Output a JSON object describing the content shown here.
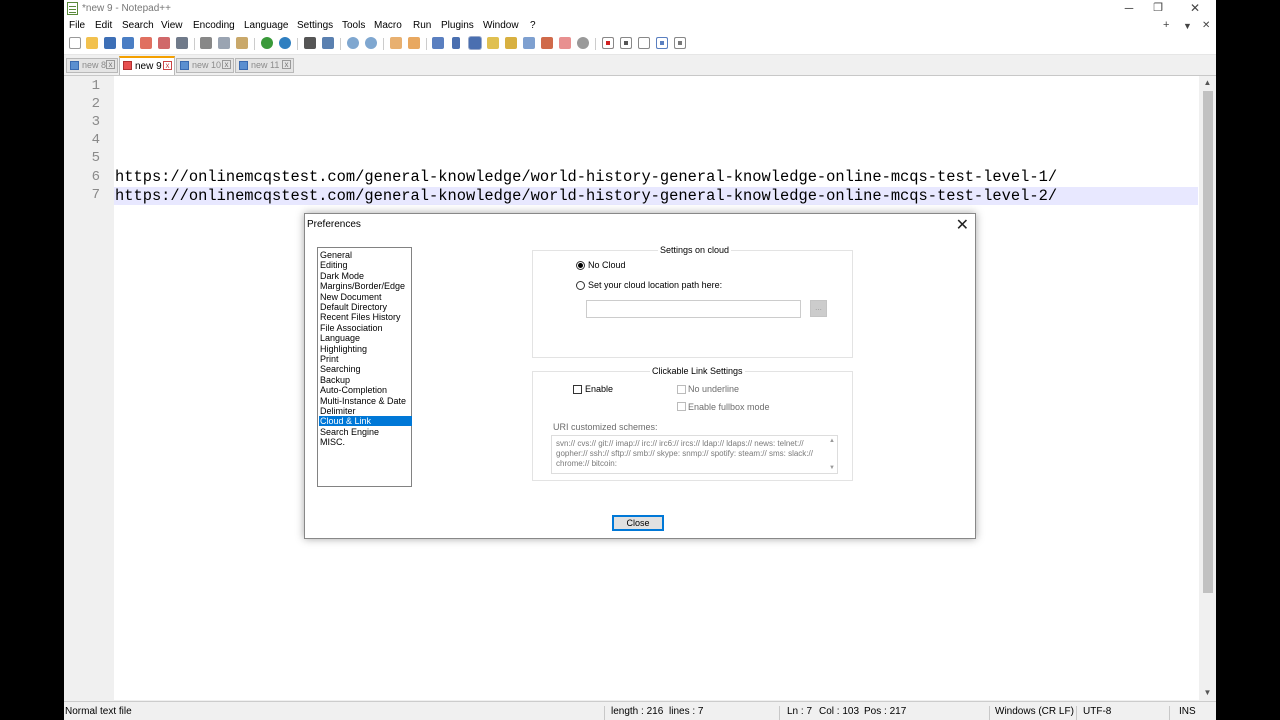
{
  "window": {
    "title": "*new 9 - Notepad++",
    "minimize": "─",
    "restore": "❐",
    "close": "✕"
  },
  "menu": [
    "File",
    "Edit",
    "Search",
    "View",
    "Encoding",
    "Language",
    "Settings",
    "Tools",
    "Macro",
    "Run",
    "Plugins",
    "Window",
    "?"
  ],
  "menu_right": {
    "plus": "+",
    "down": "▼",
    "close": "✕"
  },
  "tabs": [
    {
      "label": "new 8",
      "active": false
    },
    {
      "label": "new 9",
      "active": true
    },
    {
      "label": "new 10",
      "active": false
    },
    {
      "label": "new 11",
      "active": false
    }
  ],
  "tab_close_glyph": "x",
  "editor": {
    "line_numbers": [
      "1",
      "2",
      "3",
      "4",
      "5",
      "6",
      "7"
    ],
    "lines": [
      "",
      "",
      "",
      "",
      "",
      "https://onlinemcqstest.com/general-knowledge/world-history-general-knowledge-online-mcqs-test-level-1/",
      "https://onlinemcqstest.com/general-knowledge/world-history-general-knowledge-online-mcqs-test-level-2/"
    ]
  },
  "scroll": {
    "up": "▲",
    "down": "▼"
  },
  "status": {
    "file_type": "Normal text file",
    "length": "length : 216",
    "lines": "lines : 7",
    "ln": "Ln : 7",
    "col": "Col : 103",
    "pos": "Pos : 217",
    "eol": "Windows (CR LF)",
    "encoding": "UTF-8",
    "mode": "INS"
  },
  "dialog": {
    "title": "Preferences",
    "close_x": "✕",
    "categories": [
      "General",
      "Editing",
      "Dark Mode",
      "Margins/Border/Edge",
      "New Document",
      "Default Directory",
      "Recent Files History",
      "File Association",
      "Language",
      "Highlighting",
      "Print",
      "Searching",
      "Backup",
      "Auto-Completion",
      "Multi-Instance & Date",
      "Delimiter",
      "Cloud & Link",
      "Search Engine",
      "MISC."
    ],
    "selected_category": "Cloud & Link",
    "cloud": {
      "title": "Settings on cloud",
      "no_cloud": "No Cloud",
      "set_path": "Set your cloud location path here:",
      "path_value": "",
      "browse": "..."
    },
    "links": {
      "title": "Clickable Link Settings",
      "enable": "Enable",
      "no_underline": "No underline",
      "fullbox": "Enable fullbox mode",
      "uri_label": "URI customized schemes:",
      "uri_value": "svn:// cvs:// git:// imap:// irc:// irc6:// ircs:// ldap:// ldaps:// news: telnet:// gopher:// ssh:// sftp:// smb:// skype: snmp:// spotify: steam:// sms: slack:// chrome:// bitcoin:"
    },
    "close_button": "Close"
  },
  "colors": {
    "accent": "#0078d7",
    "tab_active": "#f4a000",
    "current_line": "#e8e8ff"
  }
}
